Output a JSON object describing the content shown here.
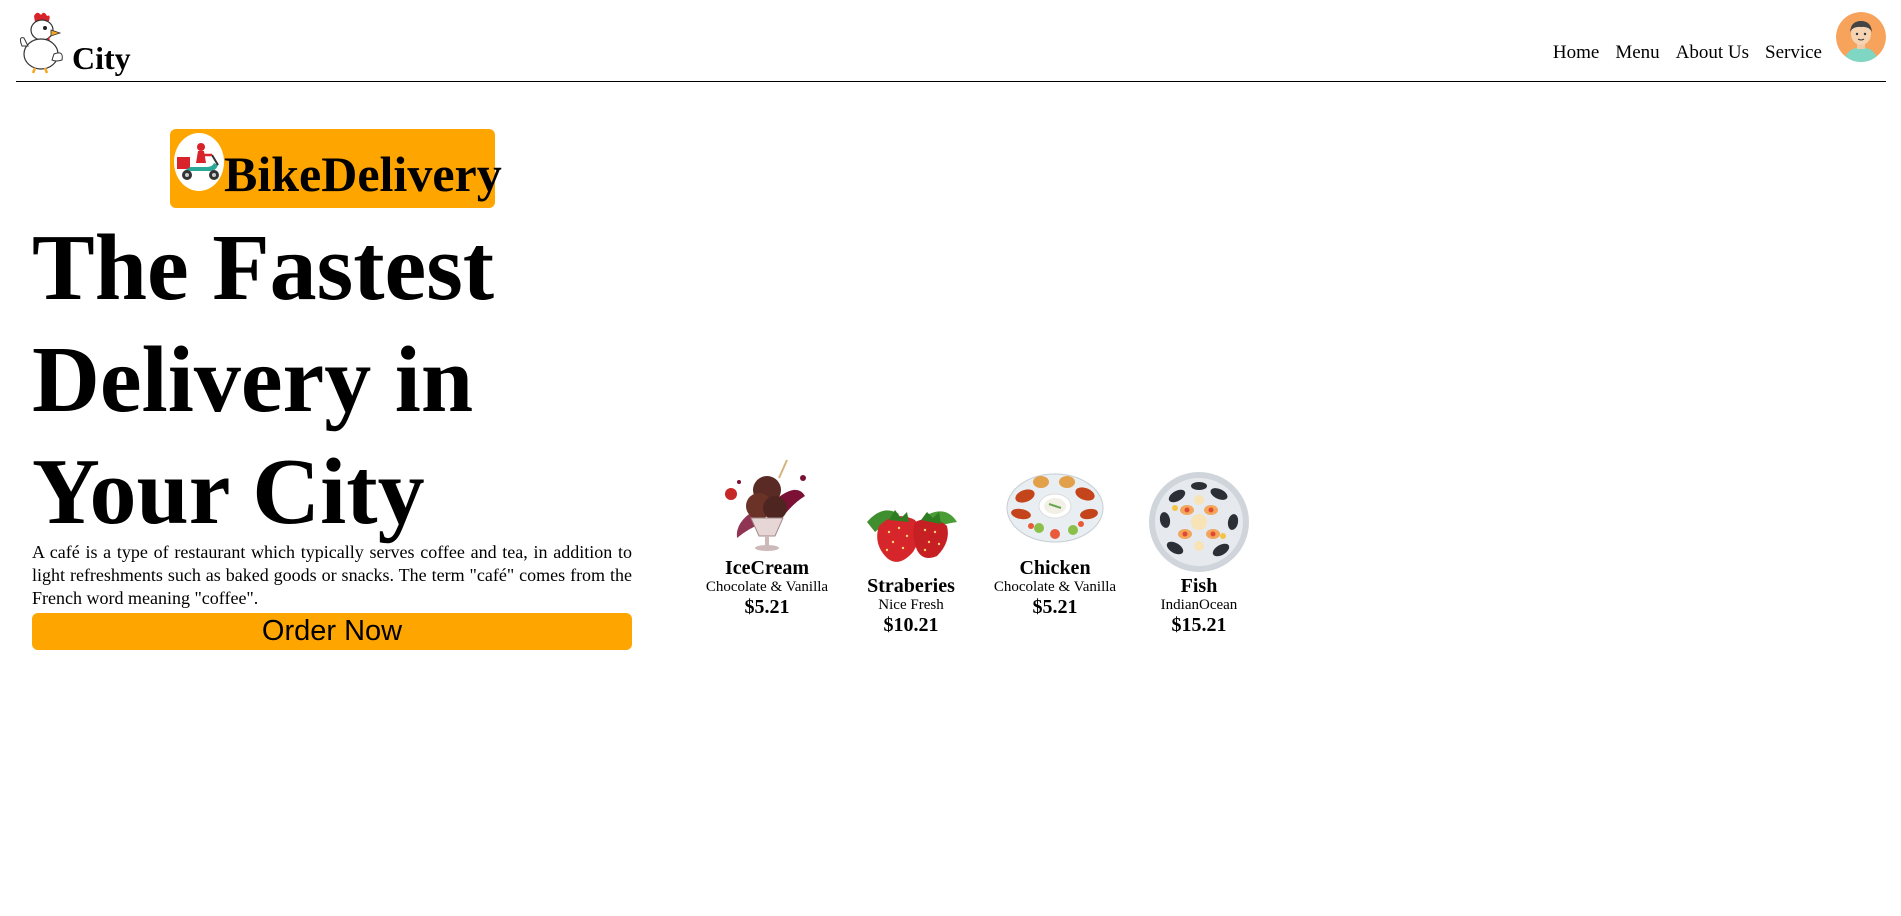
{
  "header": {
    "brand": "City",
    "nav": [
      "Home",
      "Menu",
      "About Us",
      "Service"
    ]
  },
  "hero": {
    "badge_text": "BikeDelivery",
    "title": "The Fastest Delivery in Your City",
    "description": "A café is a type of restaurant which typically serves coffee and tea, in addition to light refreshments such as baked goods or snacks. The term \"café\" comes from the French word meaning \"coffee\".",
    "order_button": "Order Now"
  },
  "foods": [
    {
      "name": "IceCream",
      "desc": "Chocolate & Vanilla",
      "price": "$5.21"
    },
    {
      "name": "Straberies",
      "desc": "Nice Fresh",
      "price": "$10.21"
    },
    {
      "name": "Chicken",
      "desc": "Chocolate & Vanilla",
      "price": "$5.21"
    },
    {
      "name": "Fish",
      "desc": "IndianOcean",
      "price": "$15.21"
    }
  ],
  "colors": {
    "accent": "#ffa500",
    "text": "#000000",
    "background": "#ffffff"
  }
}
